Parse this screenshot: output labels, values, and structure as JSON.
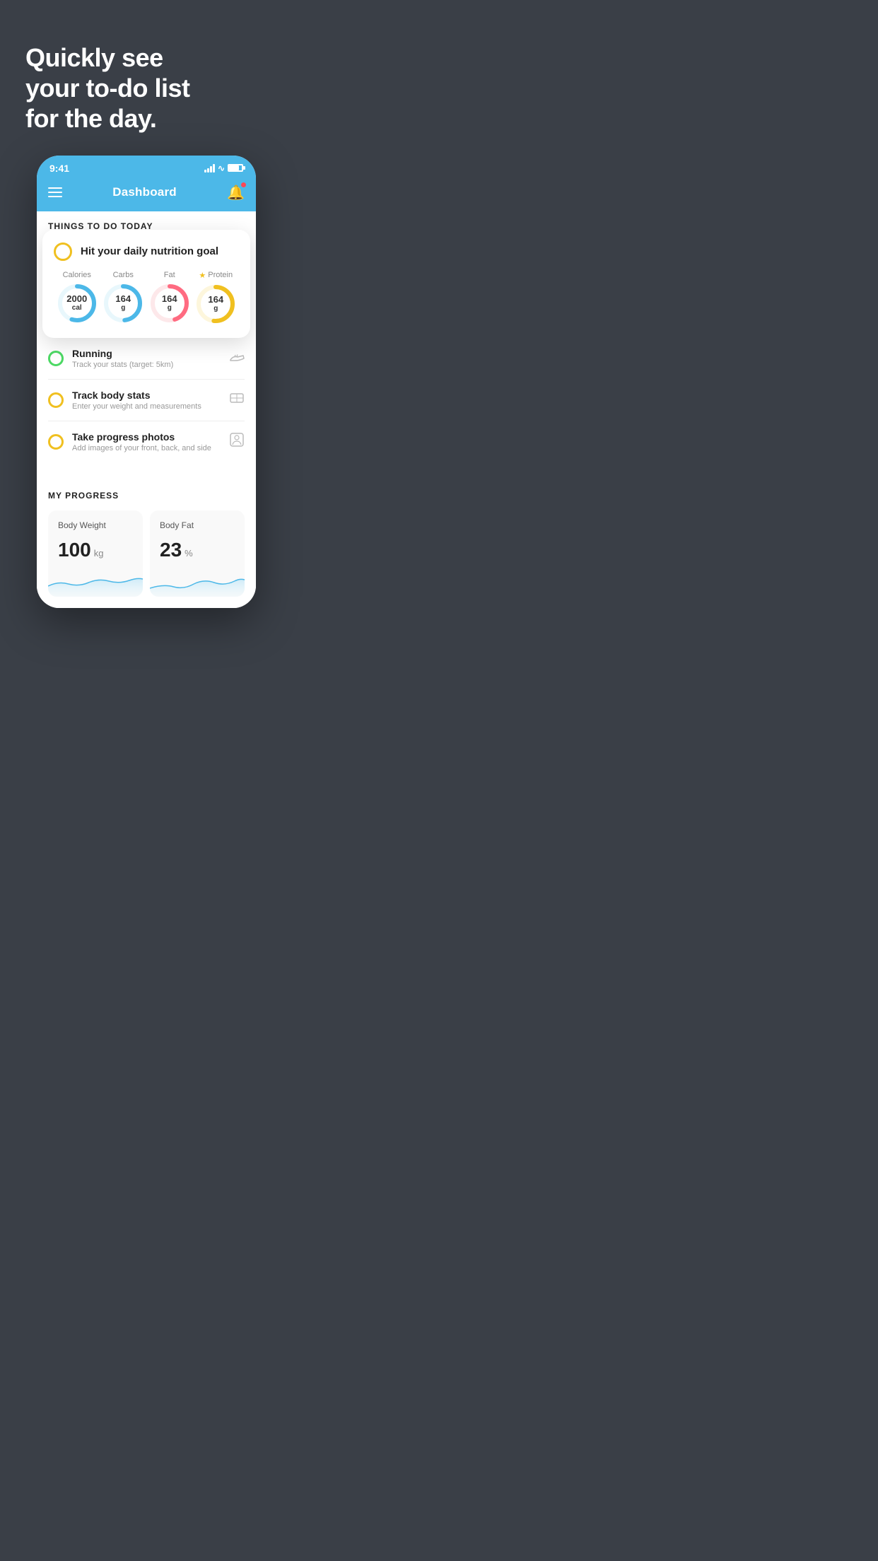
{
  "hero": {
    "line1": "Quickly see",
    "line2": "your to-do list",
    "line3": "for the day."
  },
  "statusBar": {
    "time": "9:41"
  },
  "header": {
    "title": "Dashboard"
  },
  "thingsToDo": {
    "sectionTitle": "THINGS TO DO TODAY"
  },
  "nutritionCard": {
    "title": "Hit your daily nutrition goal",
    "items": [
      {
        "label": "Calories",
        "value": "2000",
        "unit": "cal",
        "color": "#4cb8e8",
        "hasStar": false
      },
      {
        "label": "Carbs",
        "value": "164",
        "unit": "g",
        "color": "#4cb8e8",
        "hasStar": false
      },
      {
        "label": "Fat",
        "value": "164",
        "unit": "g",
        "color": "#ff6b81",
        "hasStar": false
      },
      {
        "label": "Protein",
        "value": "164",
        "unit": "g",
        "color": "#f0c020",
        "hasStar": true
      }
    ]
  },
  "todoItems": [
    {
      "type": "green",
      "title": "Running",
      "subtitle": "Track your stats (target: 5km)",
      "icon": "shoe"
    },
    {
      "type": "yellow",
      "title": "Track body stats",
      "subtitle": "Enter your weight and measurements",
      "icon": "scale"
    },
    {
      "type": "yellow",
      "title": "Take progress photos",
      "subtitle": "Add images of your front, back, and side",
      "icon": "person"
    }
  ],
  "progressSection": {
    "title": "MY PROGRESS",
    "cards": [
      {
        "title": "Body Weight",
        "value": "100",
        "unit": "kg"
      },
      {
        "title": "Body Fat",
        "value": "23",
        "unit": "%"
      }
    ]
  }
}
